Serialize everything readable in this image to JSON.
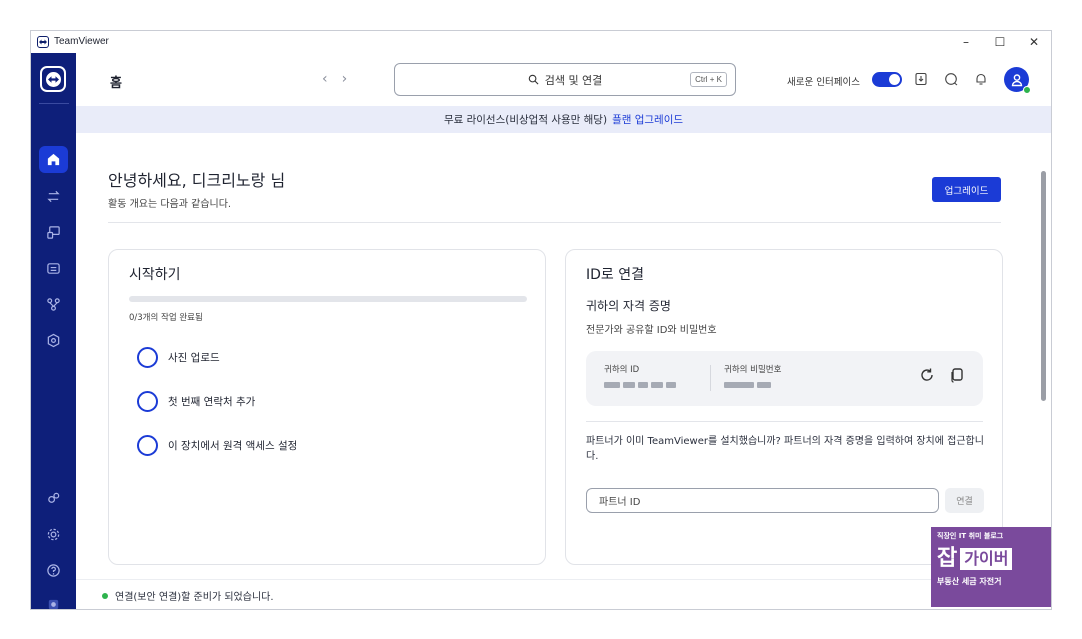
{
  "window": {
    "title": "TeamViewer",
    "controls": [
      "–",
      "☐",
      "✕"
    ]
  },
  "sidebar": {
    "items": [
      {
        "name": "home-icon",
        "active": true
      },
      {
        "name": "transfer-icon",
        "active": false
      },
      {
        "name": "remote-devices-icon",
        "active": false
      },
      {
        "name": "device-group-icon",
        "active": false
      },
      {
        "name": "branch-icon",
        "active": false
      },
      {
        "name": "security-icon",
        "active": false
      }
    ],
    "bottom_items": [
      {
        "name": "people-icon"
      },
      {
        "name": "settings-icon"
      },
      {
        "name": "help-icon"
      },
      {
        "name": "record-icon"
      }
    ]
  },
  "header": {
    "title": "홈",
    "search_text": "검색 및 연결",
    "search_shortcut": "Ctrl + K",
    "new_ui_label": "새로운 인터페이스",
    "new_ui_enabled": true,
    "accent_color": "#1b3bd6"
  },
  "banner": {
    "text": "무료 라이선스(비상업적 사용만 해당)",
    "link": "플랜 업그레이드"
  },
  "main": {
    "greeting": "안녕하세요, 디크리노랑 님",
    "subtitle": "활동 개요는 다음과 같습니다.",
    "upgrade_label": "업그레이드"
  },
  "getting_started": {
    "title": "시작하기",
    "progress_text": "0/3개의 작업 완료됨",
    "progress_fraction": 0,
    "tasks": [
      "사진 업로드",
      "첫 번째 연락처 추가",
      "이 장치에서 원격 액세스 설정"
    ]
  },
  "connect": {
    "title": "ID로 연결",
    "cred_title": "귀하의 자격 증명",
    "cred_sub": "전문가와 공유할 ID와 비밀번호",
    "id_label": "귀하의 ID",
    "password_label": "귀하의 비밀번호",
    "partner_desc": "파트너가 이미 TeamViewer를 설치했습니까? 파트너의 자격 증명을 입력하여 장치에 접근합니다.",
    "partner_placeholder": "파트너 ID",
    "connect_label": "연결"
  },
  "status": {
    "text": "연결(보안 연결)할 준비가 되었습니다.",
    "color": "#2eb34d"
  },
  "watermark": {
    "top": "직장인 IT 취미 블로그",
    "big": "잡",
    "box": "가이버",
    "bottom": "부동산 세금 자전거"
  }
}
